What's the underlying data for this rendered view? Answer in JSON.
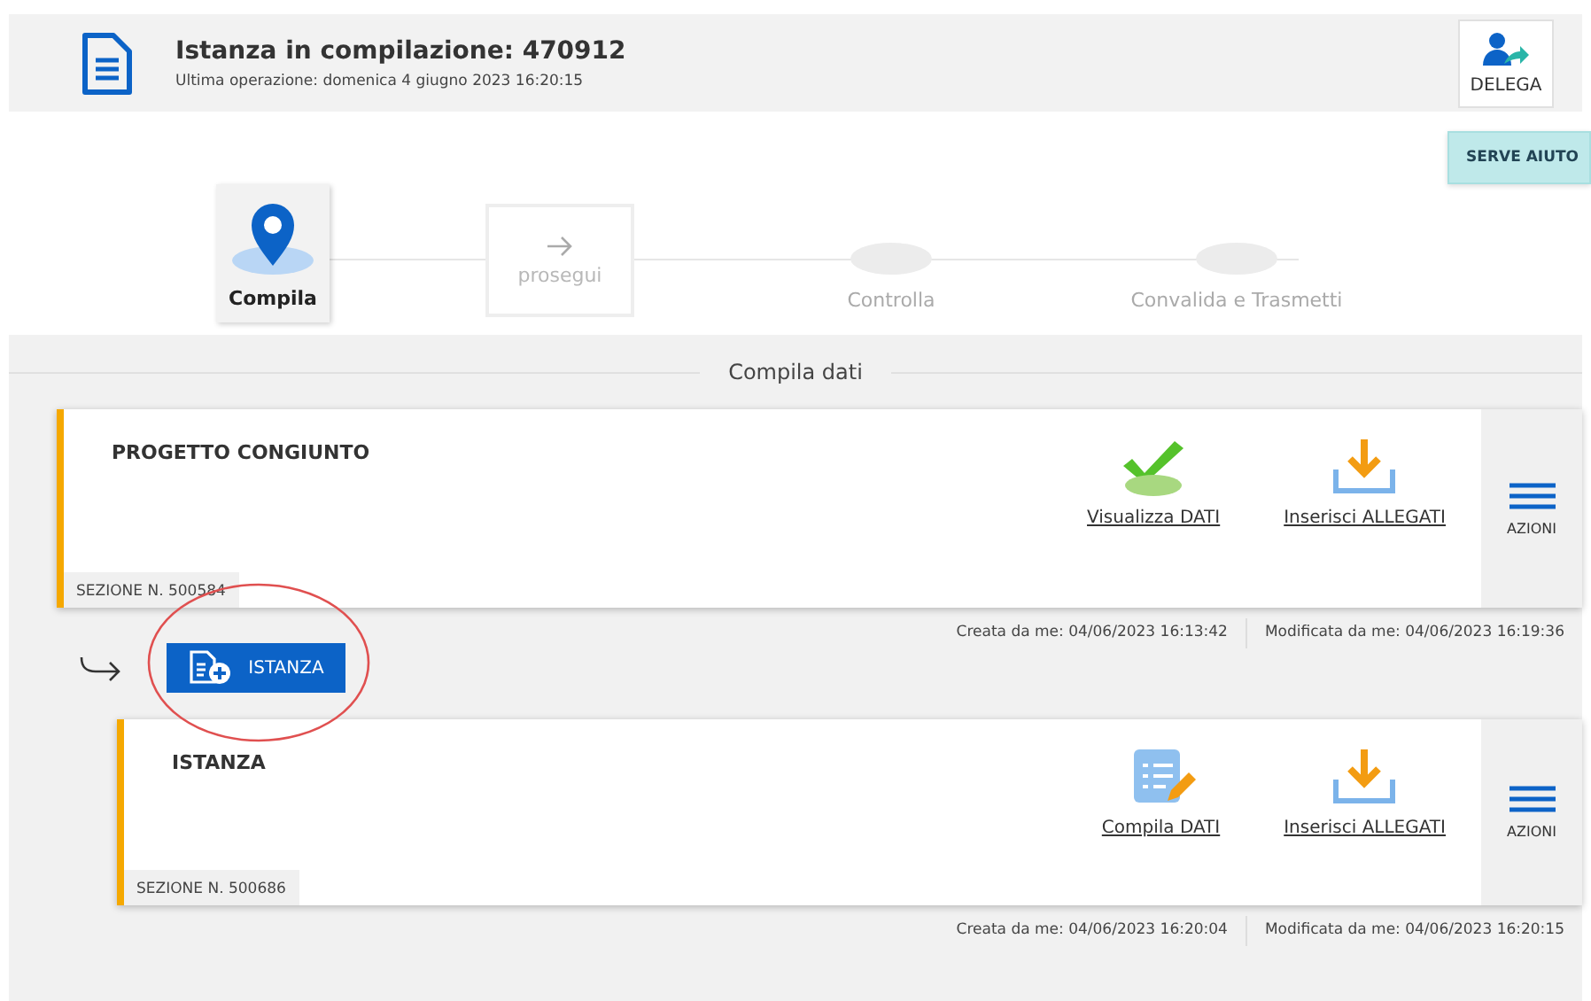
{
  "header": {
    "title": "Istanza in compilazione: 470912",
    "subtitle": "Ultima operazione: domenica 4 giugno 2023 16:20:15",
    "delega_label": "DELEGA"
  },
  "help_button": "SERVE AIUTO",
  "steps": [
    {
      "kind": "current",
      "label": "Compila"
    },
    {
      "kind": "next",
      "label": "prosegui"
    },
    {
      "kind": "pending",
      "label": "Controlla"
    },
    {
      "kind": "pending",
      "label": "Convalida e Trasmetti"
    }
  ],
  "section_title": "Compila dati",
  "sections": [
    {
      "title": "PROGETTO CONGIUNTO",
      "section_number": "SEZIONE N. 500584",
      "actions": [
        {
          "kind": "view",
          "label": "Visualizza DATI"
        },
        {
          "kind": "upload",
          "label": "Inserisci ALLEGATI"
        }
      ],
      "menu_label": "AZIONI",
      "created": "Creata da me: 04/06/2023 16:13:42",
      "modified": "Modificata da me: 04/06/2023 16:19:36",
      "add_button": {
        "label": "ISTANZA",
        "highlighted": true
      },
      "children": [
        {
          "title": "ISTANZA",
          "section_number": "SEZIONE N. 500686",
          "actions": [
            {
              "kind": "edit",
              "label": "Compila DATI"
            },
            {
              "kind": "upload",
              "label": "Inserisci ALLEGATI"
            }
          ],
          "menu_label": "AZIONI",
          "created": "Creata da me: 04/06/2023 16:20:04",
          "modified": "Modificata da me: 04/06/2023 16:20:15"
        }
      ]
    }
  ]
}
